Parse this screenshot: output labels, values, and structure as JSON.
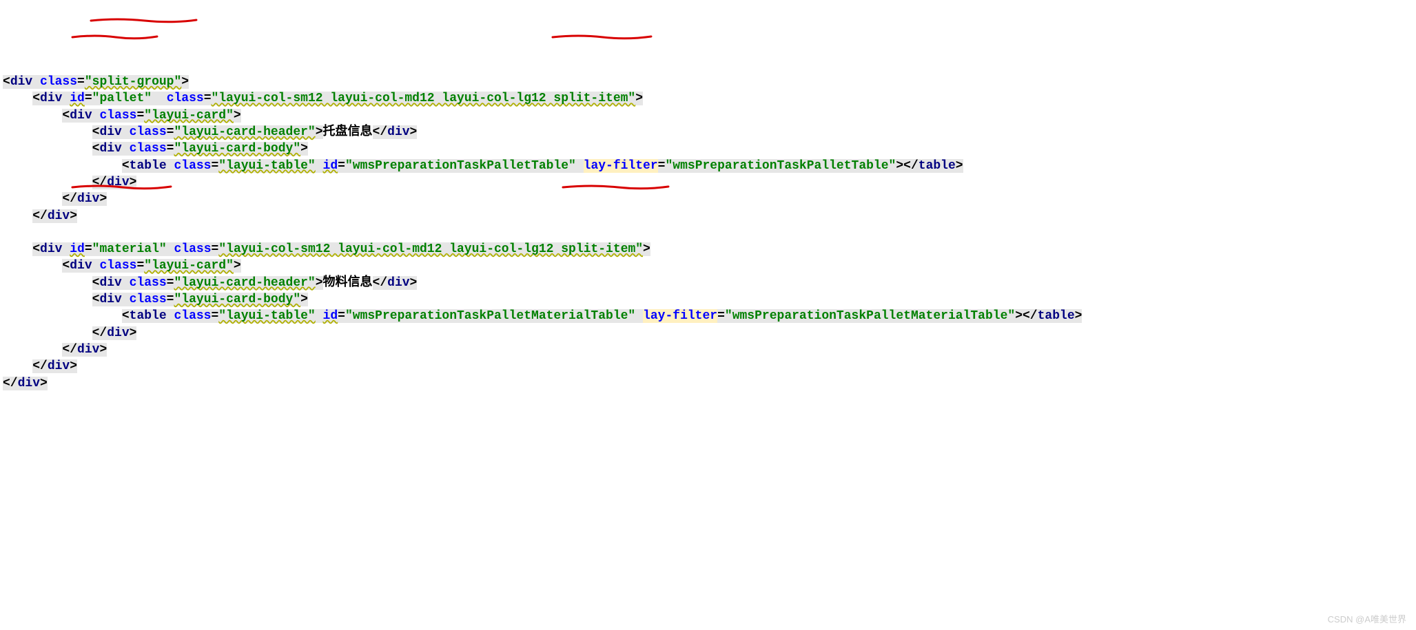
{
  "code": {
    "l1": {
      "ind": "",
      "lt": "<",
      "tag": "div",
      "sp": " ",
      "a1n": "class",
      "eq": "=",
      "a1v": "\"split-group\"",
      "gt": ">"
    },
    "l2": {
      "ind": "    ",
      "lt": "<",
      "tag": "div",
      "sp1": " ",
      "a1n": "id",
      "eq": "=",
      "a1v": "\"pallet\"",
      "sp2": "  ",
      "a2n": "class",
      "a2v": "\"layui-col-sm12 layui-col-md12 layui-col-lg12 split-item\"",
      "gt": ">"
    },
    "l3": {
      "ind": "        ",
      "lt": "<",
      "tag": "div",
      "sp": " ",
      "a1n": "class",
      "eq": "=",
      "a1v": "\"layui-card\"",
      "gt": ">"
    },
    "l4": {
      "ind": "            ",
      "lt": "<",
      "tag": "div",
      "sp": " ",
      "a1n": "class",
      "eq": "=",
      "a1v": "\"layui-card-header\"",
      "gt": ">",
      "txt": "托盘信息",
      "lt2": "</",
      "tag2": "div",
      "gt2": ">"
    },
    "l5": {
      "ind": "            ",
      "lt": "<",
      "tag": "div",
      "sp": " ",
      "a1n": "class",
      "eq": "=",
      "a1v": "\"layui-card-body\"",
      "gt": ">"
    },
    "l6": {
      "ind": "                ",
      "lt": "<",
      "tag": "table",
      "sp1": " ",
      "a1n": "class",
      "eq": "=",
      "a1v": "\"layui-table\"",
      "sp2": " ",
      "a2n": "id",
      "a2v": "\"wmsPreparationTaskPalletTable\"",
      "sp3": " ",
      "a3n": "lay-filter",
      "a3v": "\"wmsPreparationTaskPalletTable\"",
      "gt": ">",
      "lt2": "</",
      "tag2": "table",
      "gt2": ">"
    },
    "l7": {
      "ind": "            ",
      "lt": "</",
      "tag": "div",
      "gt": ">"
    },
    "l8": {
      "ind": "        ",
      "lt": "</",
      "tag": "div",
      "gt": ">"
    },
    "l9": {
      "ind": "    ",
      "lt": "</",
      "tag": "div",
      "gt": ">"
    },
    "blank": "",
    "l10": {
      "ind": "    ",
      "lt": "<",
      "tag": "div",
      "sp1": " ",
      "a1n": "id",
      "eq": "=",
      "a1v": "\"material\"",
      "sp2": " ",
      "a2n": "class",
      "a2v": "\"layui-col-sm12 layui-col-md12 layui-col-lg12 split-item\"",
      "gt": ">"
    },
    "l11": {
      "ind": "        ",
      "lt": "<",
      "tag": "div",
      "sp": " ",
      "a1n": "class",
      "eq": "=",
      "a1v": "\"layui-card\"",
      "gt": ">"
    },
    "l12": {
      "ind": "            ",
      "lt": "<",
      "tag": "div",
      "sp": " ",
      "a1n": "class",
      "eq": "=",
      "a1v": "\"layui-card-header\"",
      "gt": ">",
      "txt": "物料信息",
      "lt2": "</",
      "tag2": "div",
      "gt2": ">"
    },
    "l13": {
      "ind": "            ",
      "lt": "<",
      "tag": "div",
      "sp": " ",
      "a1n": "class",
      "eq": "=",
      "a1v": "\"layui-card-body\"",
      "gt": ">"
    },
    "l14": {
      "ind": "                ",
      "lt": "<",
      "tag": "table",
      "sp1": " ",
      "a1n": "class",
      "eq": "=",
      "a1v": "\"layui-table\"",
      "sp2": " ",
      "a2n": "id",
      "a2v": "\"wmsPreparationTaskPalletMaterialTable\"",
      "sp3": " ",
      "a3n": "lay-filter",
      "a3v": "\"wmsPreparationTaskPalletMaterialTable\"",
      "gt": ">",
      "lt2": "</",
      "tag2": "table",
      "gt2": ">"
    },
    "l15": {
      "ind": "            ",
      "lt": "</",
      "tag": "div",
      "gt": ">"
    },
    "l16": {
      "ind": "        ",
      "lt": "</",
      "tag": "div",
      "gt": ">"
    },
    "l17": {
      "ind": "    ",
      "lt": "</",
      "tag": "div",
      "gt": ">"
    },
    "l18": {
      "ind": "",
      "lt": "</",
      "tag": "div",
      "gt": ">"
    }
  },
  "watermark": "CSDN @A唯美世界"
}
